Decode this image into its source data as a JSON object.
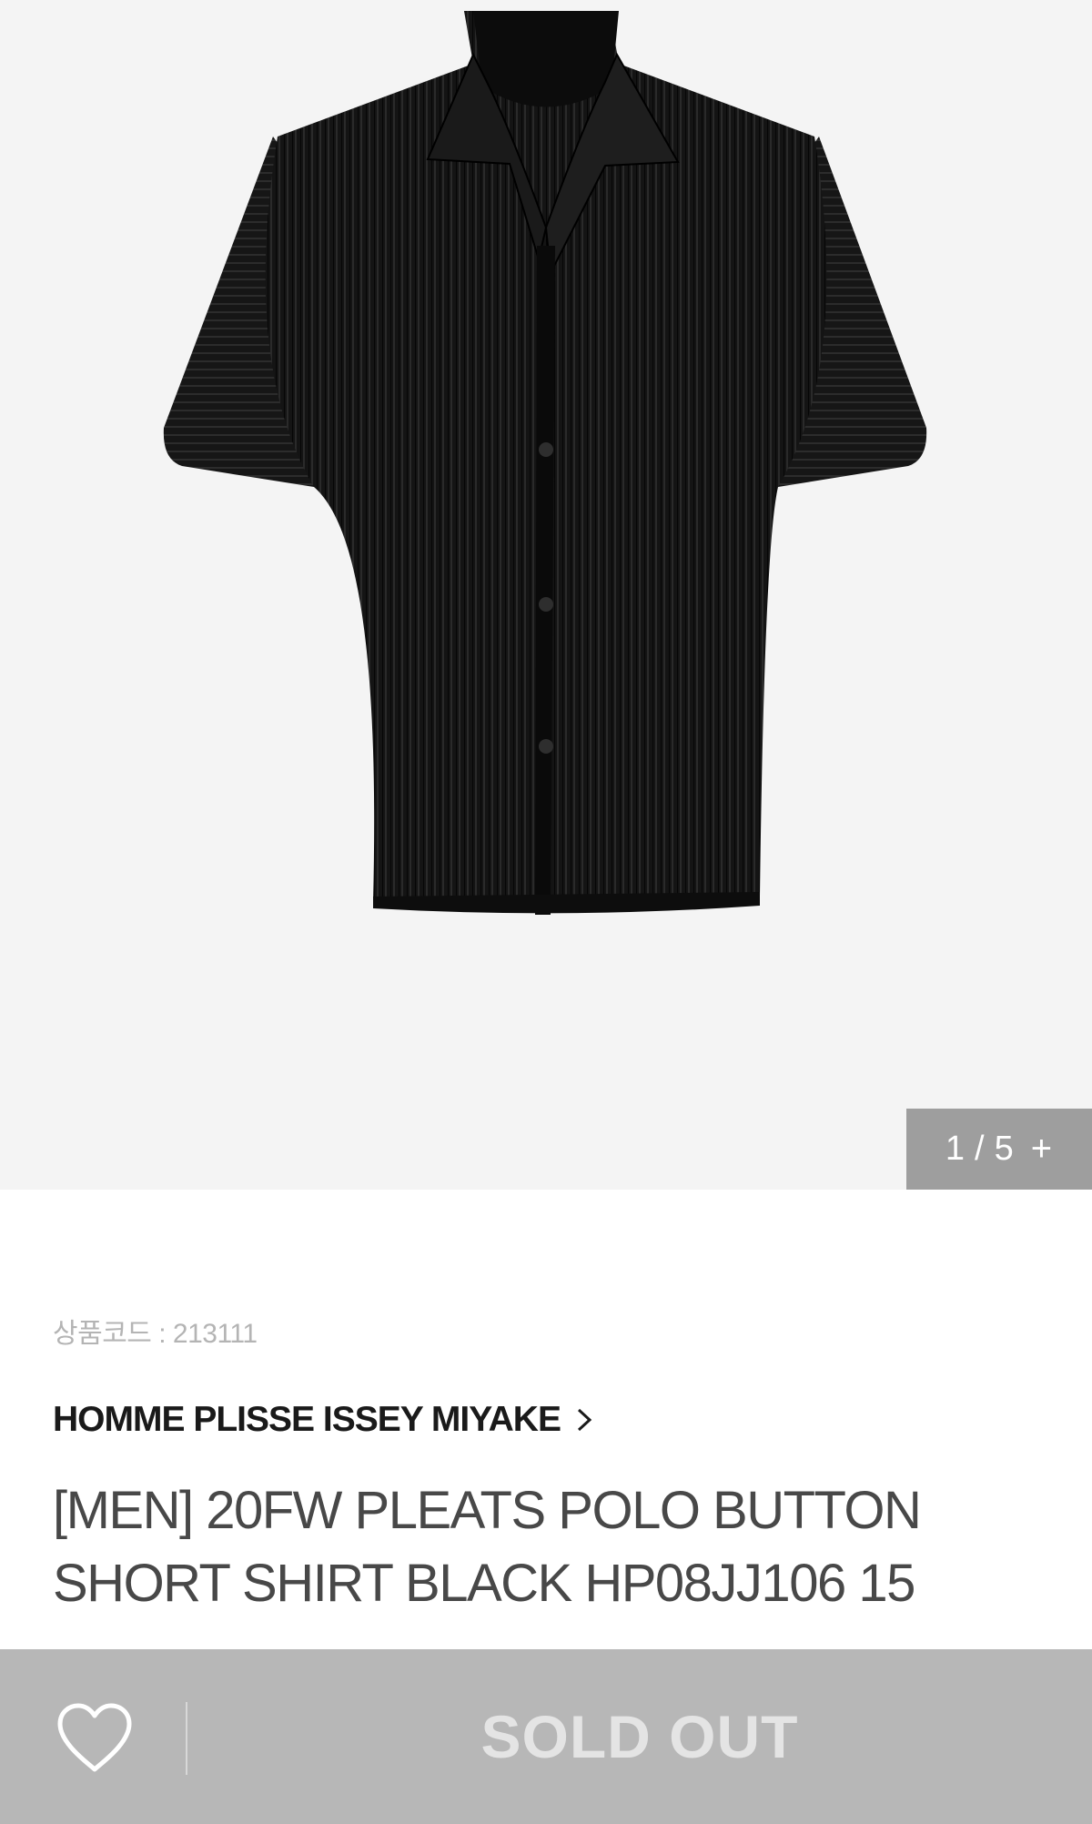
{
  "gallery": {
    "image_alt": "Black pleated short sleeve button shirt",
    "counter": {
      "current": "1",
      "separator": "/",
      "total": "5",
      "more": "+"
    }
  },
  "product": {
    "code_label": "상품코드 : 213111",
    "brand": "HOMME PLISSE ISSEY MIYAKE",
    "title": "[MEN] 20FW PLEATS POLO BUTTON SHORT SHIRT BLACK HP08JJ106 15"
  },
  "bottom_bar": {
    "wishlist_icon": "heart-outline-icon",
    "status_label": "SOLD OUT"
  },
  "colors": {
    "image_background": "#f4f4f4",
    "shirt": "#111111",
    "counter_bg": "#9e9e9e",
    "bottom_bar_bg": "#b7b7b7",
    "sold_out_text": "#e4e4e4"
  }
}
